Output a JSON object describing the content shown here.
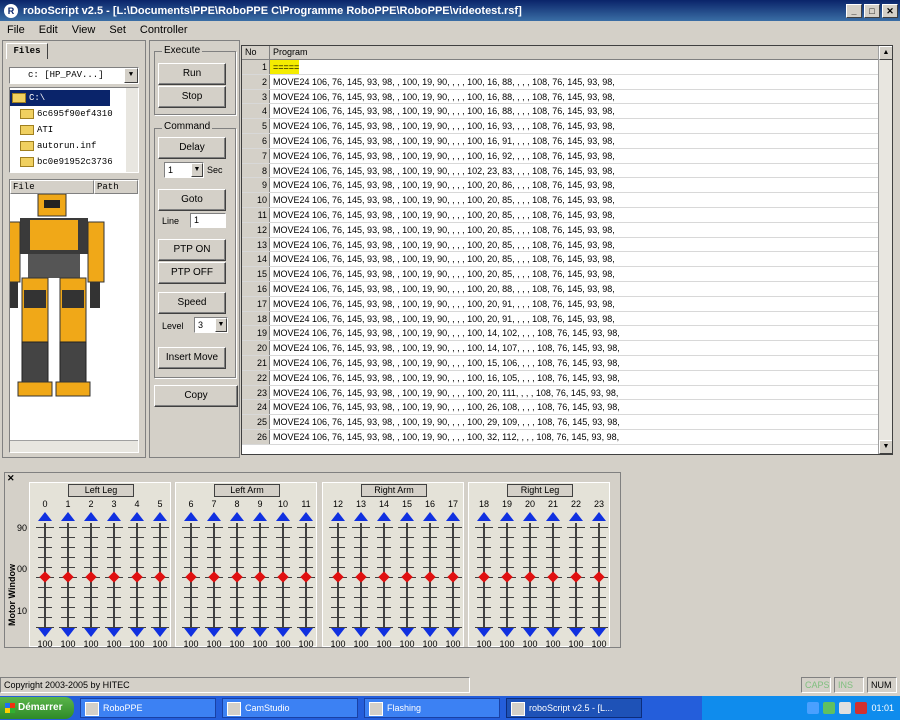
{
  "window": {
    "title": "roboScript v2.5 - [L:\\Documents\\PPE\\RoboPPE C\\Programme RoboPPE\\RoboPPE\\videotest.rsf]"
  },
  "menu": [
    "File",
    "Edit",
    "View",
    "Set",
    "Controller"
  ],
  "left": {
    "tab": "Files",
    "drive": "c: [HP_PAV...]",
    "tree": [
      "C:\\",
      "6c695f90ef4310",
      "ATI",
      "autorun.inf",
      "bc0e91952c3736"
    ],
    "file_header": "File",
    "path_header": "Path"
  },
  "execute": {
    "label": "Execute",
    "run": "Run",
    "stop": "Stop"
  },
  "command": {
    "label": "Command",
    "delay": "Delay",
    "delay_value": "1",
    "sec": "Sec",
    "goto": "Goto",
    "line_label": "Line",
    "line_value": "1",
    "ptp_on": "PTP ON",
    "ptp_off": "PTP OFF",
    "speed": "Speed",
    "level_label": "Level",
    "level_value": "3",
    "insert_move": "Insert Move"
  },
  "copy": "Copy",
  "grid": {
    "col_no": "No",
    "col_program": "Program",
    "rows": [
      {
        "no": "1",
        "prog": "=====",
        "sel": true
      },
      {
        "no": "2",
        "prog": "MOVE24 106, 76, 145, 93, 98, , 100, 19, 90, , , , 100, 16, 88, , , , 108, 76, 145, 93, 98,"
      },
      {
        "no": "3",
        "prog": "MOVE24 106, 76, 145, 93, 98, , 100, 19, 90, , , , 100, 16, 88, , , , 108, 76, 145, 93, 98,"
      },
      {
        "no": "4",
        "prog": "MOVE24 106, 76, 145, 93, 98, , 100, 19, 90, , , , 100, 16, 88, , , , 108, 76, 145, 93, 98,"
      },
      {
        "no": "5",
        "prog": "MOVE24 106, 76, 145, 93, 98, , 100, 19, 90, , , , 100, 16, 93, , , , 108, 76, 145, 93, 98,"
      },
      {
        "no": "6",
        "prog": "MOVE24 106, 76, 145, 93, 98, , 100, 19, 90, , , , 100, 16, 91, , , , 108, 76, 145, 93, 98,"
      },
      {
        "no": "7",
        "prog": "MOVE24 106, 76, 145, 93, 98, , 100, 19, 90, , , , 100, 16, 92, , , , 108, 76, 145, 93, 98,"
      },
      {
        "no": "8",
        "prog": "MOVE24 106, 76, 145, 93, 98, , 100, 19, 90, , , , 102, 23, 83, , , , 108, 76, 145, 93, 98,"
      },
      {
        "no": "9",
        "prog": "MOVE24 106, 76, 145, 93, 98, , 100, 19, 90, , , , 100, 20, 86, , , , 108, 76, 145, 93, 98,"
      },
      {
        "no": "10",
        "prog": "MOVE24 106, 76, 145, 93, 98, , 100, 19, 90, , , , 100, 20, 85, , , , 108, 76, 145, 93, 98,"
      },
      {
        "no": "11",
        "prog": "MOVE24 106, 76, 145, 93, 98, , 100, 19, 90, , , , 100, 20, 85, , , , 108, 76, 145, 93, 98,"
      },
      {
        "no": "12",
        "prog": "MOVE24 106, 76, 145, 93, 98, , 100, 19, 90, , , , 100, 20, 85, , , , 108, 76, 145, 93, 98,"
      },
      {
        "no": "13",
        "prog": "MOVE24 106, 76, 145, 93, 98, , 100, 19, 90, , , , 100, 20, 85, , , , 108, 76, 145, 93, 98,"
      },
      {
        "no": "14",
        "prog": "MOVE24 106, 76, 145, 93, 98, , 100, 19, 90, , , , 100, 20, 85, , , , 108, 76, 145, 93, 98,"
      },
      {
        "no": "15",
        "prog": "MOVE24 106, 76, 145, 93, 98, , 100, 19, 90, , , , 100, 20, 85, , , , 108, 76, 145, 93, 98,"
      },
      {
        "no": "16",
        "prog": "MOVE24 106, 76, 145, 93, 98, , 100, 19, 90, , , , 100, 20, 88, , , , 108, 76, 145, 93, 98,"
      },
      {
        "no": "17",
        "prog": "MOVE24 106, 76, 145, 93, 98, , 100, 19, 90, , , , 100, 20, 91, , , , 108, 76, 145, 93, 98,"
      },
      {
        "no": "18",
        "prog": "MOVE24 106, 76, 145, 93, 98, , 100, 19, 90, , , , 100, 20, 91, , , , 108, 76, 145, 93, 98,"
      },
      {
        "no": "19",
        "prog": "MOVE24 106, 76, 145, 93, 98, , 100, 19, 90, , , , 100, 14, 102, , , , 108, 76, 145, 93, 98,"
      },
      {
        "no": "20",
        "prog": "MOVE24 106, 76, 145, 93, 98, , 100, 19, 90, , , , 100, 14, 107, , , , 108, 76, 145, 93, 98,"
      },
      {
        "no": "21",
        "prog": "MOVE24 106, 76, 145, 93, 98, , 100, 19, 90, , , , 100, 15, 106, , , , 108, 76, 145, 93, 98,"
      },
      {
        "no": "22",
        "prog": "MOVE24 106, 76, 145, 93, 98, , 100, 19, 90, , , , 100, 16, 105, , , , 108, 76, 145, 93, 98,"
      },
      {
        "no": "23",
        "prog": "MOVE24 106, 76, 145, 93, 98, , 100, 19, 90, , , , 100, 20, 111, , , , 108, 76, 145, 93, 98,"
      },
      {
        "no": "24",
        "prog": "MOVE24 106, 76, 145, 93, 98, , 100, 19, 90, , , , 100, 26, 108, , , , 108, 76, 145, 93, 98,"
      },
      {
        "no": "25",
        "prog": "MOVE24 106, 76, 145, 93, 98, , 100, 19, 90, , , , 100, 29, 109, , , , 108, 76, 145, 93, 98,"
      },
      {
        "no": "26",
        "prog": "MOVE24 106, 76, 145, 93, 98, , 100, 19, 90, , , , 100, 32, 112, , , , 108, 76, 145, 93, 98,"
      }
    ]
  },
  "motor": {
    "side_label": "Motor Window",
    "scale": [
      "90",
      "00",
      "10"
    ],
    "groups": [
      {
        "label": "Left Leg",
        "servos": [
          "0",
          "1",
          "2",
          "3",
          "4",
          "5"
        ]
      },
      {
        "label": "Left Arm",
        "servos": [
          "6",
          "7",
          "8",
          "9",
          "10",
          "11"
        ]
      },
      {
        "label": "Right Arm",
        "servos": [
          "12",
          "13",
          "14",
          "15",
          "16",
          "17"
        ]
      },
      {
        "label": "Right Leg",
        "servos": [
          "18",
          "19",
          "20",
          "21",
          "22",
          "23"
        ]
      }
    ],
    "value": "100"
  },
  "status": {
    "copyright": "Copyright 2003-2005 by HITEC",
    "caps": "CAPS",
    "num": "NUM",
    "ins": "INS"
  },
  "taskbar": {
    "start": "Démarrer",
    "tasks": [
      "RoboPPE",
      "CamStudio",
      "Flashing",
      "roboScript v2.5 - [L..."
    ],
    "clock": "01:01"
  }
}
